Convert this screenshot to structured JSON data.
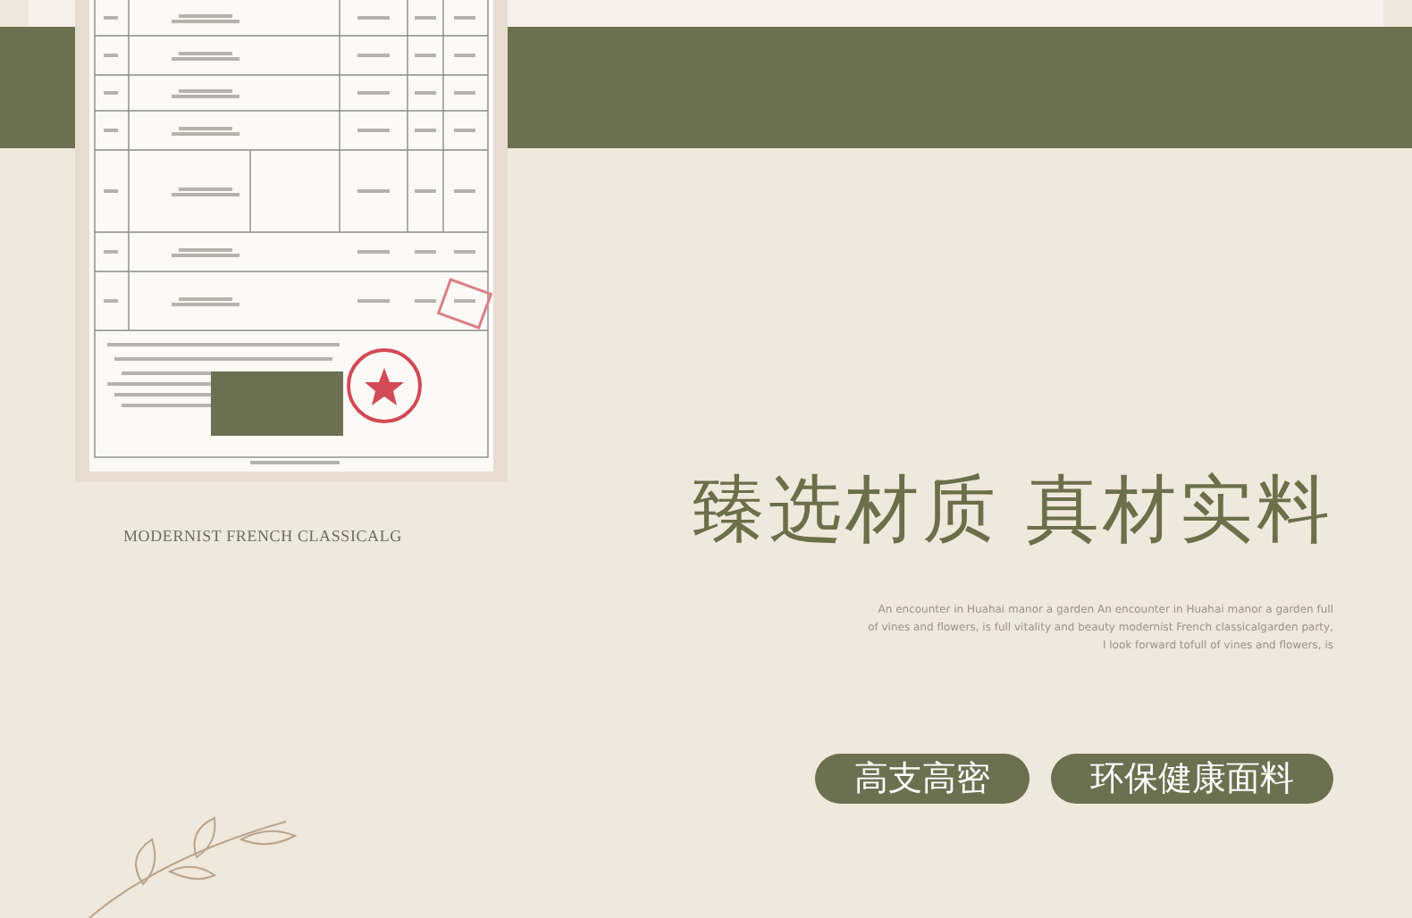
{
  "subtitle": "MODERNIST FRENCH CLASSICALG",
  "heading": "臻选材质 真材实料",
  "description": "An encounter in Huahai manor a garden An encounter in Huahai manor a garden full of vines and flowers, is full vitality and beauty modernist French classicalgarden party, I look forward tofull of vines and flowers, is",
  "tags": [
    "高支高密",
    "环保健康面料"
  ]
}
